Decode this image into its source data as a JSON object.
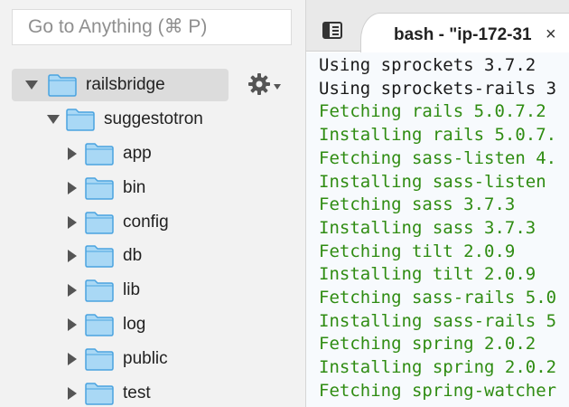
{
  "search": {
    "placeholder": "Go to Anything (⌘ P)"
  },
  "tree": {
    "root": "railsbridge",
    "project": "suggestotron",
    "folders": [
      "app",
      "bin",
      "config",
      "db",
      "lib",
      "log",
      "public",
      "test"
    ]
  },
  "terminal": {
    "tab_title": "bash - \"ip-172-31",
    "close_glyph": "×",
    "colors": {
      "default": "#1a1a1a",
      "success": "#2f8c12"
    },
    "lines": [
      {
        "text": "Using sprockets 3.7.2",
        "kind": "default"
      },
      {
        "text": "Using sprockets-rails 3",
        "kind": "default"
      },
      {
        "text": "Fetching rails 5.0.7.2",
        "kind": "success"
      },
      {
        "text": "Installing rails 5.0.7.",
        "kind": "success"
      },
      {
        "text": "Fetching sass-listen 4.",
        "kind": "success"
      },
      {
        "text": "Installing sass-listen",
        "kind": "success"
      },
      {
        "text": "Fetching sass 3.7.3",
        "kind": "success"
      },
      {
        "text": "Installing sass 3.7.3",
        "kind": "success"
      },
      {
        "text": "Fetching tilt 2.0.9",
        "kind": "success"
      },
      {
        "text": "Installing tilt 2.0.9",
        "kind": "success"
      },
      {
        "text": "Fetching sass-rails 5.0",
        "kind": "success"
      },
      {
        "text": "Installing sass-rails 5",
        "kind": "success"
      },
      {
        "text": "Fetching spring 2.0.2",
        "kind": "success"
      },
      {
        "text": "Installing spring 2.0.2",
        "kind": "success"
      },
      {
        "text": "Fetching spring-watcher",
        "kind": "success"
      }
    ]
  },
  "icons": {
    "settings": "gear-icon",
    "menu": "tab-menu-icon",
    "folder": "folder-icon",
    "expanded": "triangle-down-icon",
    "collapsed": "triangle-right-icon"
  }
}
